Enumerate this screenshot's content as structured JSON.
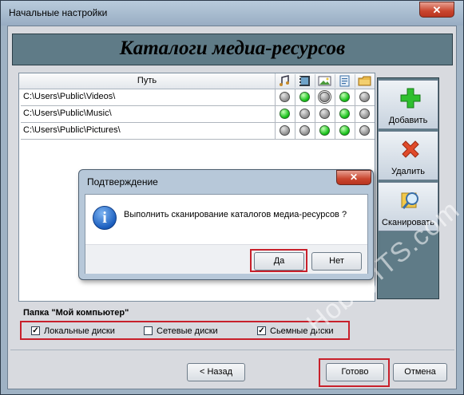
{
  "window": {
    "title": "Начальные настройки",
    "close_glyph": "✕"
  },
  "banner": {
    "title": "Каталоги медиа-ресурсов"
  },
  "table": {
    "header_path": "Путь",
    "column_icons": [
      "music-icon",
      "video-icon",
      "picture-icon",
      "document-icon",
      "folder-icon"
    ],
    "rows": [
      {
        "path": "C:\\Users\\Public\\Videos\\",
        "status": [
          "gray",
          "green",
          "gray-ring",
          "green",
          "gray"
        ]
      },
      {
        "path": "C:\\Users\\Public\\Music\\",
        "status": [
          "green",
          "gray",
          "gray",
          "green",
          "gray"
        ]
      },
      {
        "path": "C:\\Users\\Public\\Pictures\\",
        "status": [
          "gray",
          "gray",
          "green",
          "green",
          "gray"
        ]
      }
    ]
  },
  "sidebar": {
    "add_label": "Добавить",
    "delete_label": "Удалить",
    "scan_label": "Сканировать"
  },
  "computer_group": {
    "label": "Папка \"Мой компьютер\"",
    "options": [
      {
        "label": "Локальные диски",
        "checked": true
      },
      {
        "label": "Сетевые диски",
        "checked": false
      },
      {
        "label": "Сьемные диски",
        "checked": true
      }
    ]
  },
  "footer": {
    "back_label": "< Назад",
    "done_label": "Готово",
    "cancel_label": "Отмена"
  },
  "dialog": {
    "title": "Подтверждение",
    "close_glyph": "✕",
    "message": "Выполнить сканирование каталогов медиа-ресурсов ?",
    "icon_glyph": "i",
    "yes_label": "Да",
    "no_label": "Нет"
  },
  "watermark": {
    "text": "HobbyITS.com"
  },
  "colors": {
    "highlight": "#c8202b",
    "status_green": "#18c21a",
    "status_gray": "#8d8d8d",
    "banner": "#5f7b87"
  }
}
